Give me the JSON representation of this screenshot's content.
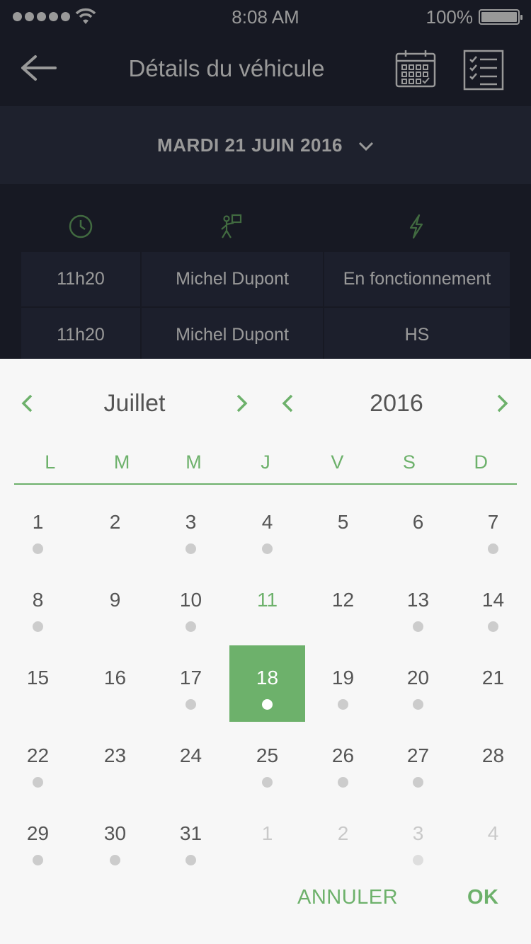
{
  "status_bar": {
    "time": "8:08 AM",
    "battery": "100%"
  },
  "header": {
    "title": "Détails du véhicule"
  },
  "date_bar": {
    "label": "MARDI 21 JUIN 2016"
  },
  "table": {
    "rows": [
      [
        "11h20",
        "Michel Dupont",
        "En fonctionnement"
      ],
      [
        "11h20",
        "Michel Dupont",
        "HS"
      ]
    ]
  },
  "colors": {
    "accent": "#6db16b",
    "background_dark": "#272b3b",
    "sheet": "#f7f7f7"
  },
  "picker": {
    "month": "Juillet",
    "year": "2016",
    "weekdays": [
      "L",
      "M",
      "M",
      "J",
      "V",
      "S",
      "D"
    ]
  },
  "calendar": {
    "weeks": [
      [
        {
          "d": "1",
          "m": true
        },
        {
          "d": "2",
          "m": false
        },
        {
          "d": "3",
          "m": true
        },
        {
          "d": "4",
          "m": true
        },
        {
          "d": "5",
          "m": false
        },
        {
          "d": "6",
          "m": false
        },
        {
          "d": "7",
          "m": true
        }
      ],
      [
        {
          "d": "8",
          "m": true
        },
        {
          "d": "9",
          "m": false
        },
        {
          "d": "10",
          "m": true
        },
        {
          "d": "11",
          "m": false,
          "today": true
        },
        {
          "d": "12",
          "m": false
        },
        {
          "d": "13",
          "m": true
        },
        {
          "d": "14",
          "m": true
        }
      ],
      [
        {
          "d": "15",
          "m": false
        },
        {
          "d": "16",
          "m": false
        },
        {
          "d": "17",
          "m": true
        },
        {
          "d": "18",
          "m": true,
          "selected": true
        },
        {
          "d": "19",
          "m": true
        },
        {
          "d": "20",
          "m": true
        },
        {
          "d": "21",
          "m": false
        }
      ],
      [
        {
          "d": "22",
          "m": true
        },
        {
          "d": "23",
          "m": false
        },
        {
          "d": "24",
          "m": false
        },
        {
          "d": "25",
          "m": true
        },
        {
          "d": "26",
          "m": true
        },
        {
          "d": "27",
          "m": true
        },
        {
          "d": "28",
          "m": false
        }
      ],
      [
        {
          "d": "29",
          "m": true
        },
        {
          "d": "30",
          "m": true
        },
        {
          "d": "31",
          "m": true
        },
        {
          "d": "1",
          "m": false,
          "muted": true
        },
        {
          "d": "2",
          "m": false,
          "muted": true
        },
        {
          "d": "3",
          "m": true,
          "muted": true
        },
        {
          "d": "4",
          "m": false,
          "muted": true
        }
      ]
    ]
  },
  "actions": {
    "cancel": "ANNULER",
    "ok": "OK"
  }
}
